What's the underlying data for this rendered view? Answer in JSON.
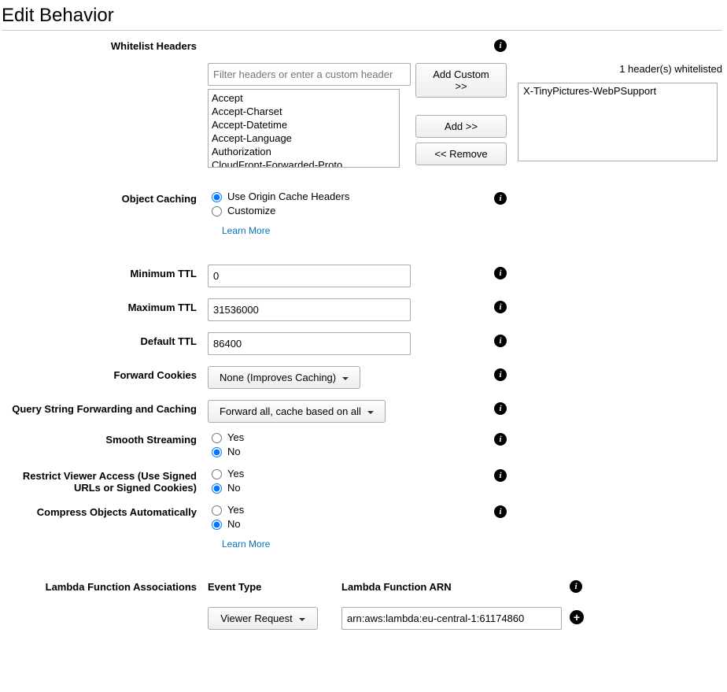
{
  "title": "Edit Behavior",
  "labels": {
    "whitelist_headers": "Whitelist Headers",
    "object_caching": "Object Caching",
    "min_ttl": "Minimum TTL",
    "max_ttl": "Maximum TTL",
    "default_ttl": "Default TTL",
    "forward_cookies": "Forward Cookies",
    "querystring": "Query String Forwarding and Caching",
    "smooth_streaming": "Smooth Streaming",
    "restrict_viewer": "Restrict Viewer Access (Use Signed URLs or Signed Cookies)",
    "compress": "Compress Objects Automatically",
    "lambda": "Lambda Function Associations",
    "event_type": "Event Type",
    "lambda_arn": "Lambda Function ARN"
  },
  "whitelist": {
    "filter_placeholder": "Filter headers or enter a custom header",
    "add_custom": "Add Custom >>",
    "add": "Add >>",
    "remove": "<< Remove",
    "counter": "1 header(s) whitelisted",
    "available": [
      "Accept",
      "Accept-Charset",
      "Accept-Datetime",
      "Accept-Language",
      "Authorization",
      "CloudFront-Forwarded-Proto"
    ],
    "selected": [
      "X-TinyPictures-WebPSupport"
    ]
  },
  "object_caching": {
    "use_origin": "Use Origin Cache Headers",
    "customize": "Customize",
    "learn_more": "Learn More"
  },
  "ttl": {
    "min": "0",
    "max": "31536000",
    "def": "86400"
  },
  "forward_cookies_value": "None (Improves Caching)",
  "querystring_value": "Forward all, cache based on all",
  "yes": "Yes",
  "no": "No",
  "learn_more": "Learn More",
  "lambda_row": {
    "event_type_value": "Viewer Request",
    "arn_value": "arn:aws:lambda:eu-central-1:61174860"
  }
}
